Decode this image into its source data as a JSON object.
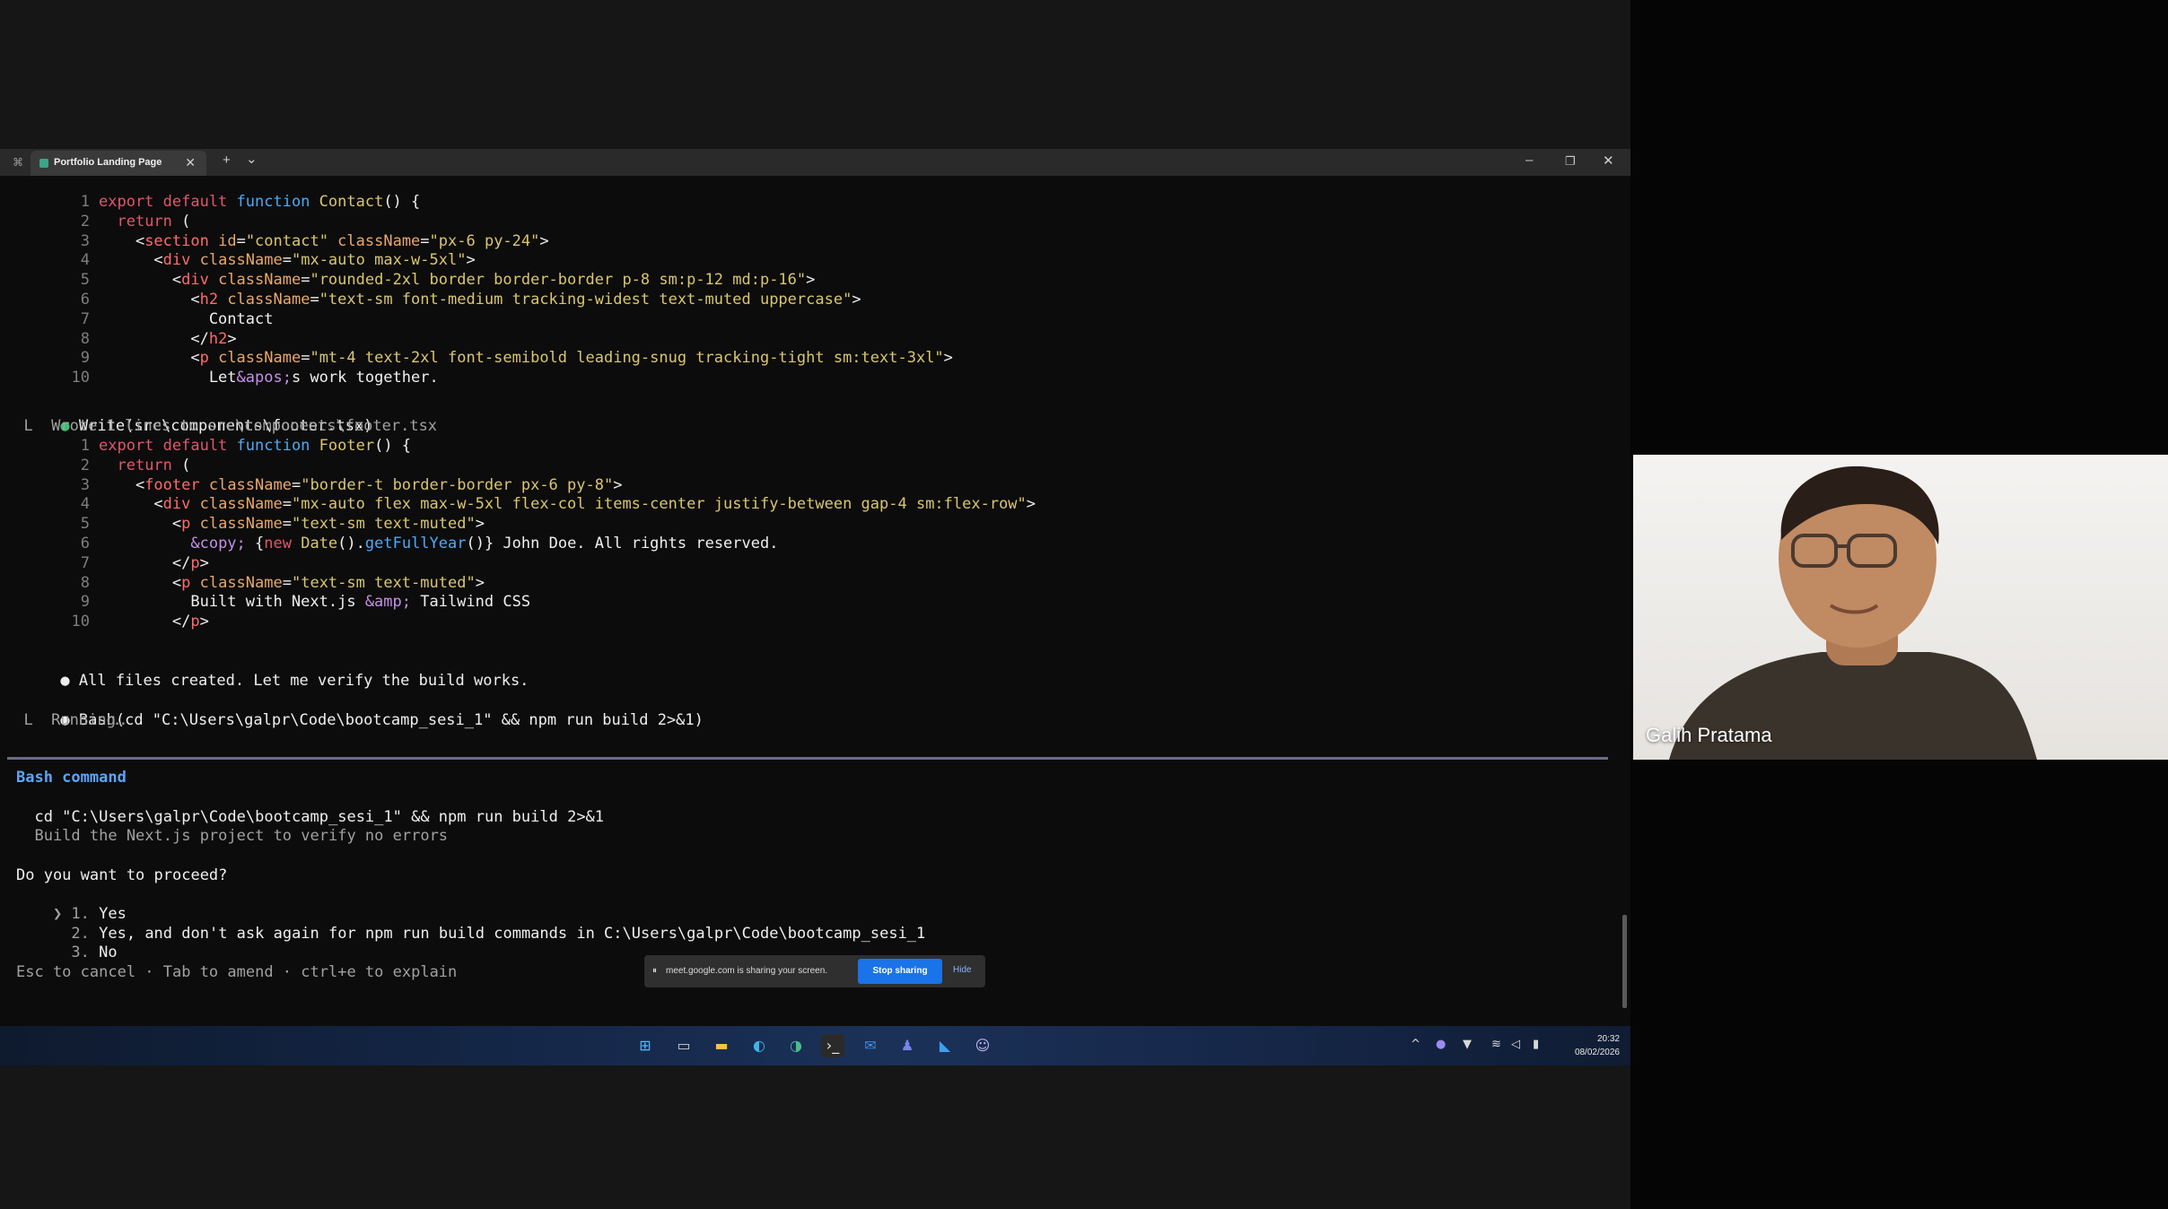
{
  "terminal": {
    "tab_title": "Portfolio Landing Page",
    "tab_close": "✕",
    "new_tab": "+",
    "tab_dropdown": "⌄",
    "minimize": "–",
    "restore": "❐",
    "close": "✕"
  },
  "contact_code": [
    {
      "n": "1",
      "parts": [
        {
          "c": "kw",
          "t": "export default "
        },
        {
          "c": "fn",
          "t": "function "
        },
        {
          "c": "str",
          "t": "Contact"
        },
        {
          "c": "wht",
          "t": "() {"
        }
      ]
    },
    {
      "n": "2",
      "parts": [
        {
          "c": "wht",
          "t": "  "
        },
        {
          "c": "kw",
          "t": "return"
        },
        {
          "c": "wht",
          "t": " ("
        }
      ]
    },
    {
      "n": "3",
      "parts": [
        {
          "c": "wht",
          "t": "    <"
        },
        {
          "c": "tag",
          "t": "section"
        },
        {
          "c": "attr",
          "t": " id"
        },
        {
          "c": "wht",
          "t": "="
        },
        {
          "c": "str",
          "t": "\"contact\""
        },
        {
          "c": "attr",
          "t": " className"
        },
        {
          "c": "wht",
          "t": "="
        },
        {
          "c": "str",
          "t": "\"px-6 py-24\""
        },
        {
          "c": "wht",
          "t": ">"
        }
      ]
    },
    {
      "n": "4",
      "parts": [
        {
          "c": "wht",
          "t": "      <"
        },
        {
          "c": "tag",
          "t": "div"
        },
        {
          "c": "attr",
          "t": " className"
        },
        {
          "c": "wht",
          "t": "="
        },
        {
          "c": "str",
          "t": "\"mx-auto max-w-5xl\""
        },
        {
          "c": "wht",
          "t": ">"
        }
      ]
    },
    {
      "n": "5",
      "parts": [
        {
          "c": "wht",
          "t": "        <"
        },
        {
          "c": "tag",
          "t": "div"
        },
        {
          "c": "attr",
          "t": " className"
        },
        {
          "c": "wht",
          "t": "="
        },
        {
          "c": "str",
          "t": "\"rounded-2xl border border-border p-8 sm:p-12 md:p-16\""
        },
        {
          "c": "wht",
          "t": ">"
        }
      ]
    },
    {
      "n": "6",
      "parts": [
        {
          "c": "wht",
          "t": "          <"
        },
        {
          "c": "tag",
          "t": "h2"
        },
        {
          "c": "attr",
          "t": " className"
        },
        {
          "c": "wht",
          "t": "="
        },
        {
          "c": "str",
          "t": "\"text-sm font-medium tracking-widest text-muted uppercase\""
        },
        {
          "c": "wht",
          "t": ">"
        }
      ]
    },
    {
      "n": "7",
      "parts": [
        {
          "c": "wht",
          "t": "            Contact"
        }
      ]
    },
    {
      "n": "8",
      "parts": [
        {
          "c": "wht",
          "t": "          </"
        },
        {
          "c": "tag",
          "t": "h2"
        },
        {
          "c": "wht",
          "t": ">"
        }
      ]
    },
    {
      "n": "9",
      "parts": [
        {
          "c": "wht",
          "t": "          <"
        },
        {
          "c": "tag",
          "t": "p"
        },
        {
          "c": "attr",
          "t": " className"
        },
        {
          "c": "wht",
          "t": "="
        },
        {
          "c": "str",
          "t": "\"mt-4 text-2xl font-semibold leading-snug tracking-tight sm:text-3xl\""
        },
        {
          "c": "wht",
          "t": ">"
        }
      ]
    },
    {
      "n": "10",
      "parts": [
        {
          "c": "wht",
          "t": "            Let"
        },
        {
          "c": "ent",
          "t": "&apos;"
        },
        {
          "c": "wht",
          "t": "s work together."
        }
      ]
    }
  ],
  "write_call": "Write(src\\components\\footer.tsx)",
  "write_result": "  L  Wrote 1 lines to src\\components\\footer.tsx",
  "footer_code": [
    {
      "n": "1",
      "parts": [
        {
          "c": "kw",
          "t": "export default "
        },
        {
          "c": "fn",
          "t": "function "
        },
        {
          "c": "str",
          "t": "Footer"
        },
        {
          "c": "wht",
          "t": "() {"
        }
      ]
    },
    {
      "n": "2",
      "parts": [
        {
          "c": "wht",
          "t": "  "
        },
        {
          "c": "kw",
          "t": "return"
        },
        {
          "c": "wht",
          "t": " ("
        }
      ]
    },
    {
      "n": "3",
      "parts": [
        {
          "c": "wht",
          "t": "    <"
        },
        {
          "c": "tag",
          "t": "footer"
        },
        {
          "c": "attr",
          "t": " className"
        },
        {
          "c": "wht",
          "t": "="
        },
        {
          "c": "str",
          "t": "\"border-t border-border px-6 py-8\""
        },
        {
          "c": "wht",
          "t": ">"
        }
      ]
    },
    {
      "n": "4",
      "parts": [
        {
          "c": "wht",
          "t": "      <"
        },
        {
          "c": "tag",
          "t": "div"
        },
        {
          "c": "attr",
          "t": " className"
        },
        {
          "c": "wht",
          "t": "="
        },
        {
          "c": "str",
          "t": "\"mx-auto flex max-w-5xl flex-col items-center justify-between gap-4 sm:flex-row\""
        },
        {
          "c": "wht",
          "t": ">"
        }
      ]
    },
    {
      "n": "5",
      "parts": [
        {
          "c": "wht",
          "t": "        <"
        },
        {
          "c": "tag",
          "t": "p"
        },
        {
          "c": "attr",
          "t": " className"
        },
        {
          "c": "wht",
          "t": "="
        },
        {
          "c": "str",
          "t": "\"text-sm text-muted\""
        },
        {
          "c": "wht",
          "t": ">"
        }
      ]
    },
    {
      "n": "6",
      "parts": [
        {
          "c": "wht",
          "t": "          "
        },
        {
          "c": "ent",
          "t": "&copy;"
        },
        {
          "c": "wht",
          "t": " {"
        },
        {
          "c": "kw",
          "t": "new "
        },
        {
          "c": "str",
          "t": "Date"
        },
        {
          "c": "wht",
          "t": "()."
        },
        {
          "c": "fn",
          "t": "getFullYear"
        },
        {
          "c": "wht",
          "t": "()} John Doe. All rights reserved."
        }
      ]
    },
    {
      "n": "7",
      "parts": [
        {
          "c": "wht",
          "t": "        </"
        },
        {
          "c": "tag",
          "t": "p"
        },
        {
          "c": "wht",
          "t": ">"
        }
      ]
    },
    {
      "n": "8",
      "parts": [
        {
          "c": "wht",
          "t": "        <"
        },
        {
          "c": "tag",
          "t": "p"
        },
        {
          "c": "attr",
          "t": " className"
        },
        {
          "c": "wht",
          "t": "="
        },
        {
          "c": "str",
          "t": "\"text-sm text-muted\""
        },
        {
          "c": "wht",
          "t": ">"
        }
      ]
    },
    {
      "n": "9",
      "parts": [
        {
          "c": "wht",
          "t": "          Built with Next.js "
        },
        {
          "c": "ent",
          "t": "&amp;"
        },
        {
          "c": "wht",
          "t": " Tailwind CSS"
        }
      ]
    },
    {
      "n": "10",
      "parts": [
        {
          "c": "wht",
          "t": "        </"
        },
        {
          "c": "tag",
          "t": "p"
        },
        {
          "c": "wht",
          "t": ">"
        }
      ]
    }
  ],
  "status_msg": "All files created. Let me verify the build works.",
  "bash_call": "Bash(cd \"C:\\Users\\galpr\\Code\\bootcamp_sesi_1\" && npm run build 2>&1)",
  "bash_running": "  L  Running…",
  "prompt": {
    "title": "Bash command",
    "command": "  cd \"C:\\Users\\galpr\\Code\\bootcamp_sesi_1\" && npm run build 2>&1",
    "description": "  Build the Next.js project to verify no errors",
    "question": "Do you want to proceed?",
    "options": [
      {
        "prefix": "❯ 1. ",
        "label": "Yes"
      },
      {
        "prefix": "  2. ",
        "label": "Yes, and don't ask again for npm run build commands in C:\\Users\\galpr\\Code\\bootcamp_sesi_1"
      },
      {
        "prefix": "  3. ",
        "label": "No"
      }
    ],
    "hints": "Esc to cancel · Tab to amend · ctrl+e to explain"
  },
  "share_bar": {
    "pause": "⏸",
    "text": "meet.google.com is sharing your screen.",
    "stop": "Stop sharing",
    "hide": "Hide"
  },
  "taskbar": {
    "clock_time": "20:32",
    "clock_date": "08/02/2026",
    "tray_chevron": "^"
  },
  "video": {
    "participant_name": "Galih Pratama"
  },
  "colors": {
    "keyword": "#e0566b",
    "function": "#4fa9f5",
    "string": "#d9c66e",
    "accent": "#1a73e8"
  }
}
